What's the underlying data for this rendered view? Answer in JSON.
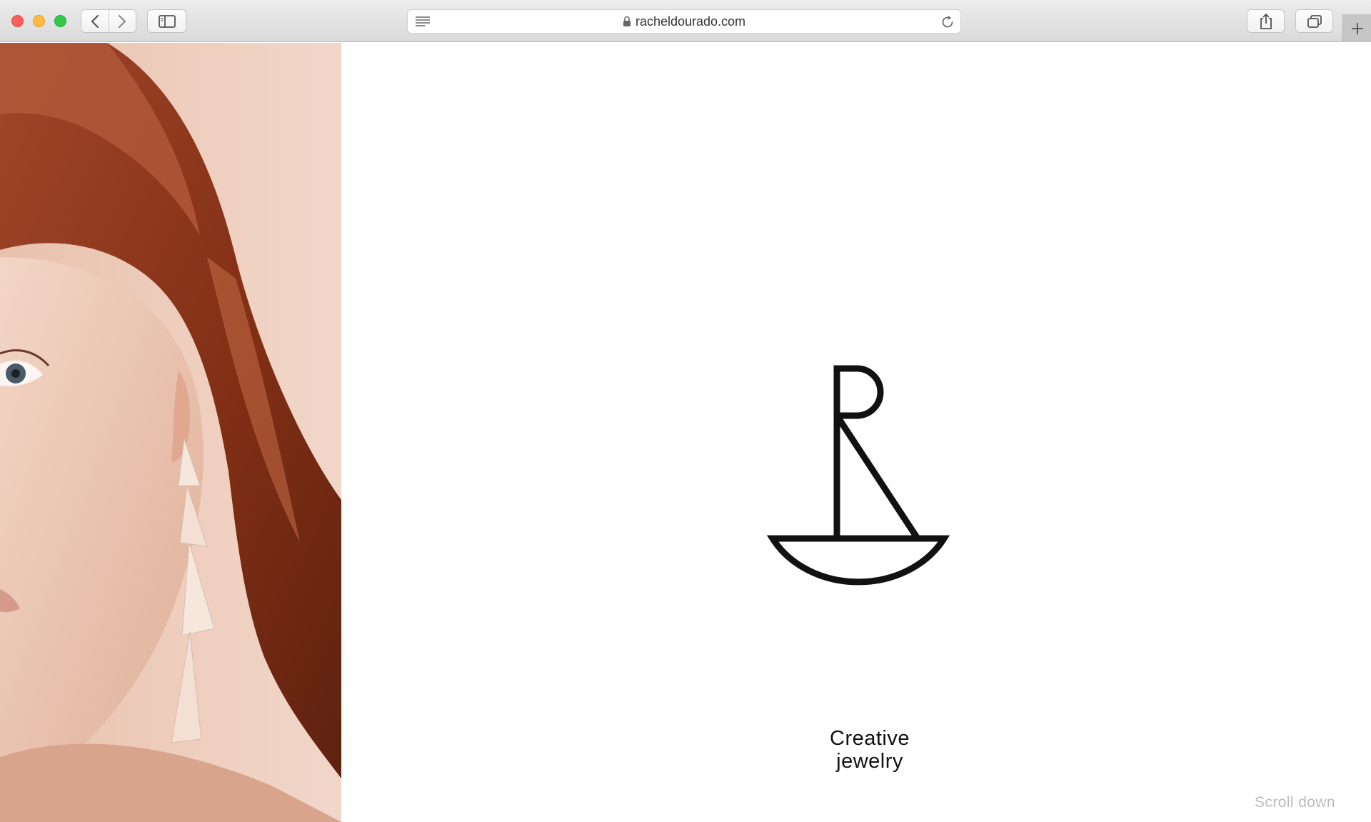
{
  "browser": {
    "url": "racheldourado.com",
    "icons": {
      "back": "chevron-left-icon",
      "forward": "chevron-right-icon",
      "sidebar": "sidebar-icon",
      "reader": "reader-icon",
      "lock": "lock-icon",
      "reload": "reload-icon",
      "share": "share-icon",
      "tabs": "tabs-icon",
      "new_tab": "plus-icon"
    },
    "colors": {
      "close": "#fc605c",
      "minimize": "#fdbc40",
      "zoom": "#34c84a"
    }
  },
  "hero": {
    "image": "woman-with-long-geometric-earring",
    "colors": {
      "hair": "#8e3a1c",
      "skin": "#f0cfbf",
      "earring": "#f5e6da"
    }
  },
  "main": {
    "tagline": {
      "line1": "Creative",
      "line2": "jewelry"
    },
    "scroll_label": "Scroll down"
  }
}
